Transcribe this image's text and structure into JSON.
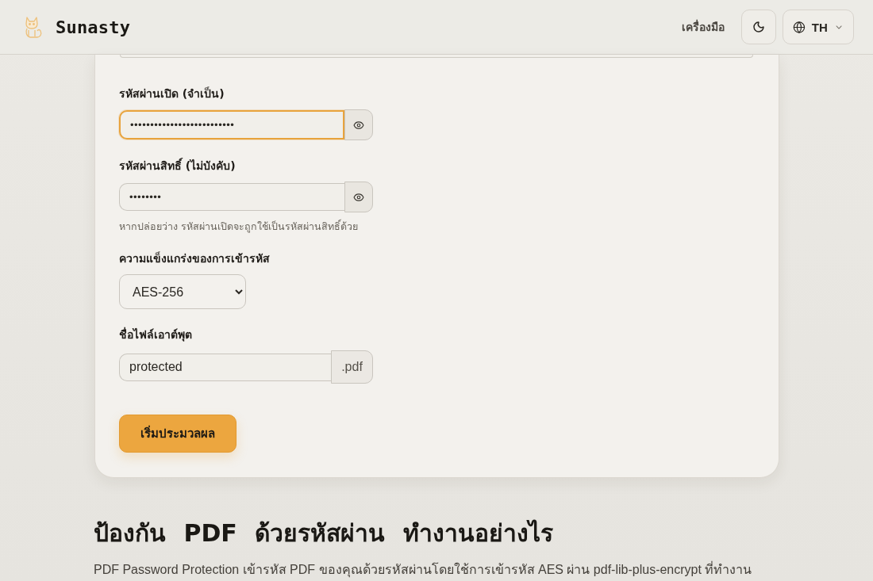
{
  "header": {
    "brand": "Sunasty",
    "nav": [
      {
        "label": "เครื่องมือ"
      }
    ],
    "language": "TH"
  },
  "form": {
    "fields": [
      {
        "kind": "password",
        "label": "รหัสผ่านเปิด (จำเป็น)",
        "value": "••••••••••••••••••••••••••",
        "focused": true,
        "revealed": false
      },
      {
        "kind": "password",
        "label": "รหัสผ่านสิทธิ์ (ไม่บังคับ)",
        "value": "••••••••",
        "focused": false,
        "revealed": false,
        "hint": "หากปล่อยว่าง รหัสผ่านเปิดจะถูกใช้เป็นรหัสผ่านสิทธิ์ด้วย"
      },
      {
        "kind": "select",
        "label": "ความแข็งแกร่งของการเข้ารหัส",
        "value": "AES-256",
        "focused": false
      },
      {
        "kind": "filename",
        "label": "ชื่อไฟล์เอาต์พุต",
        "value": "protected",
        "suffix": ".pdf",
        "focused": false
      }
    ],
    "submit": "เริ่มประมวลผล"
  },
  "article": {
    "heading": "ป้องกัน PDF ด้วยรหัสผ่าน ทำงานอย่างไร",
    "paragraph": "PDF Password Protection เข้ารหัส PDF ของคุณด้วยรหัสผ่านโดยใช้การเข้ารหัส AES ผ่าน pdf-lib-plus-encrypt ที่ทำงาน"
  }
}
